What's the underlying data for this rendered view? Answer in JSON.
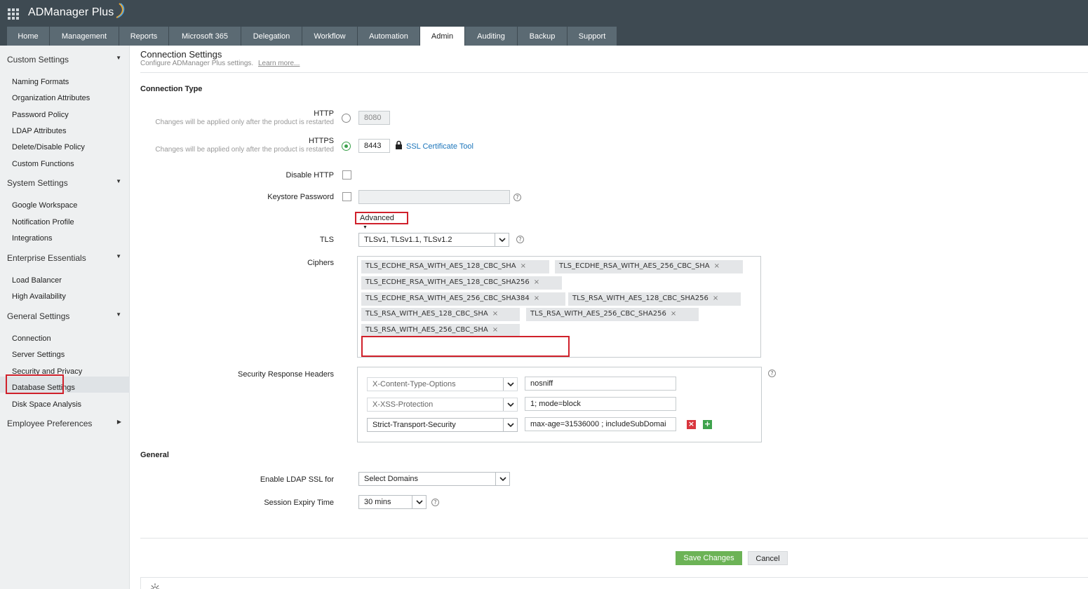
{
  "app": {
    "brand": "ADManager Plus",
    "nav_tabs": [
      {
        "label": "Home"
      },
      {
        "label": "Management"
      },
      {
        "label": "Reports"
      },
      {
        "label": "Microsoft 365"
      },
      {
        "label": "Delegation"
      },
      {
        "label": "Workflow"
      },
      {
        "label": "Automation"
      },
      {
        "label": "Admin",
        "active": true
      },
      {
        "label": "Auditing"
      },
      {
        "label": "Backup"
      },
      {
        "label": "Support"
      }
    ]
  },
  "sidebar": {
    "groups": [
      {
        "label": "Custom Settings",
        "expanded": true,
        "items": [
          "Naming Formats",
          "Organization Attributes",
          "Password Policy",
          "LDAP Attributes",
          "Delete/Disable Policy",
          "Custom Functions"
        ]
      },
      {
        "label": "System Settings",
        "expanded": true,
        "items": [
          "Google Workspace",
          "Notification Profile",
          "Integrations"
        ]
      },
      {
        "label": "Enterprise Essentials",
        "expanded": true,
        "items": [
          "Load Balancer",
          "High Availability"
        ]
      },
      {
        "label": "General Settings",
        "expanded": true,
        "items": [
          "Connection",
          "Server Settings",
          "Security and Privacy",
          "Database Settings",
          "Disk Space Analysis"
        ]
      },
      {
        "label": "Employee Preferences",
        "expanded": false,
        "items": []
      }
    ],
    "active_item": "Connection"
  },
  "main": {
    "title": "Connection Settings",
    "subtitle": "Configure ADManager Plus settings.",
    "learn_more": "Learn more...",
    "connection_type": {
      "heading": "Connection Type",
      "http_label": "HTTP",
      "http_hint": "Changes will be applied only after the product is restarted",
      "http_port": "8080",
      "https_label": "HTTPS",
      "https_hint": "Changes will be applied only after the product is restarted",
      "https_port": "8443",
      "ssl_tool": "SSL Certificate Tool",
      "selected": "HTTPS",
      "disable_http_label": "Disable HTTP",
      "keystore_label": "Keystore Password",
      "advanced_label": "Advanced",
      "tls_label": "TLS",
      "tls_value": "TLSv1, TLSv1.1, TLSv1.2",
      "ciphers_label": "Ciphers",
      "ciphers": [
        "TLS_ECDHE_RSA_WITH_AES_128_CBC_SHA",
        "TLS_ECDHE_RSA_WITH_AES_256_CBC_SHA",
        "TLS_ECDHE_RSA_WITH_AES_128_CBC_SHA256",
        "TLS_ECDHE_RSA_WITH_AES_256_CBC_SHA384",
        "TLS_RSA_WITH_AES_128_CBC_SHA256",
        "TLS_RSA_WITH_AES_128_CBC_SHA",
        "TLS_RSA_WITH_AES_256_CBC_SHA256",
        "TLS_RSA_WITH_AES_256_CBC_SHA"
      ],
      "headers_label": "Security Response Headers",
      "headers": [
        {
          "name": "X-Content-Type-Options",
          "value": "nosniff",
          "editable": false
        },
        {
          "name": "X-XSS-Protection",
          "value": "1; mode=block",
          "editable": false
        },
        {
          "name": "Strict-Transport-Security",
          "value": "max-age=31536000 ; includeSubDomai",
          "editable": true
        }
      ]
    },
    "general": {
      "heading": "General",
      "ldap_ssl_label": "Enable LDAP SSL for",
      "ldap_ssl_value": "Select Domains",
      "session_label": "Session Expiry Time",
      "session_value": "30 mins"
    },
    "buttons": {
      "save": "Save Changes",
      "cancel": "Cancel"
    }
  }
}
